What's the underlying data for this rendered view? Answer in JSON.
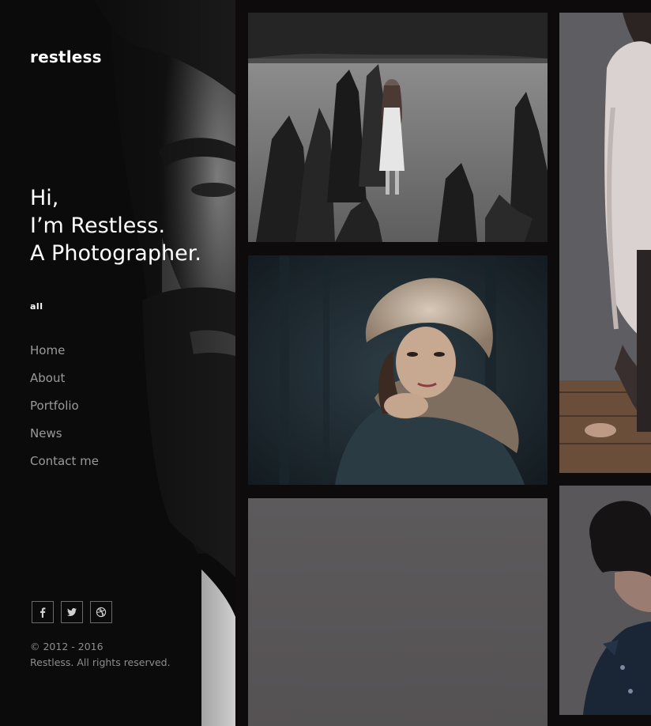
{
  "site": {
    "logo": "restless"
  },
  "intro": {
    "line1": "Hi,",
    "line2": "I’m Restless.",
    "line3": "A Photographer."
  },
  "filter": {
    "label": "all"
  },
  "nav": {
    "items": [
      {
        "label": "Home"
      },
      {
        "label": "About"
      },
      {
        "label": "Portfolio"
      },
      {
        "label": "News"
      },
      {
        "label": "Contact me"
      }
    ]
  },
  "social": [
    {
      "icon": "facebook-icon"
    },
    {
      "icon": "twitter-icon"
    },
    {
      "icon": "dribbble-icon"
    }
  ],
  "footer": {
    "copyright_years": "© 2012 - 2016",
    "rights": "Restless. All rights reserved."
  },
  "colors": {
    "page_background": "#0e0b0c",
    "sidebar_background": "#0c0b0b",
    "text_primary": "#ffffff",
    "text_muted": "#9a9a9a"
  }
}
